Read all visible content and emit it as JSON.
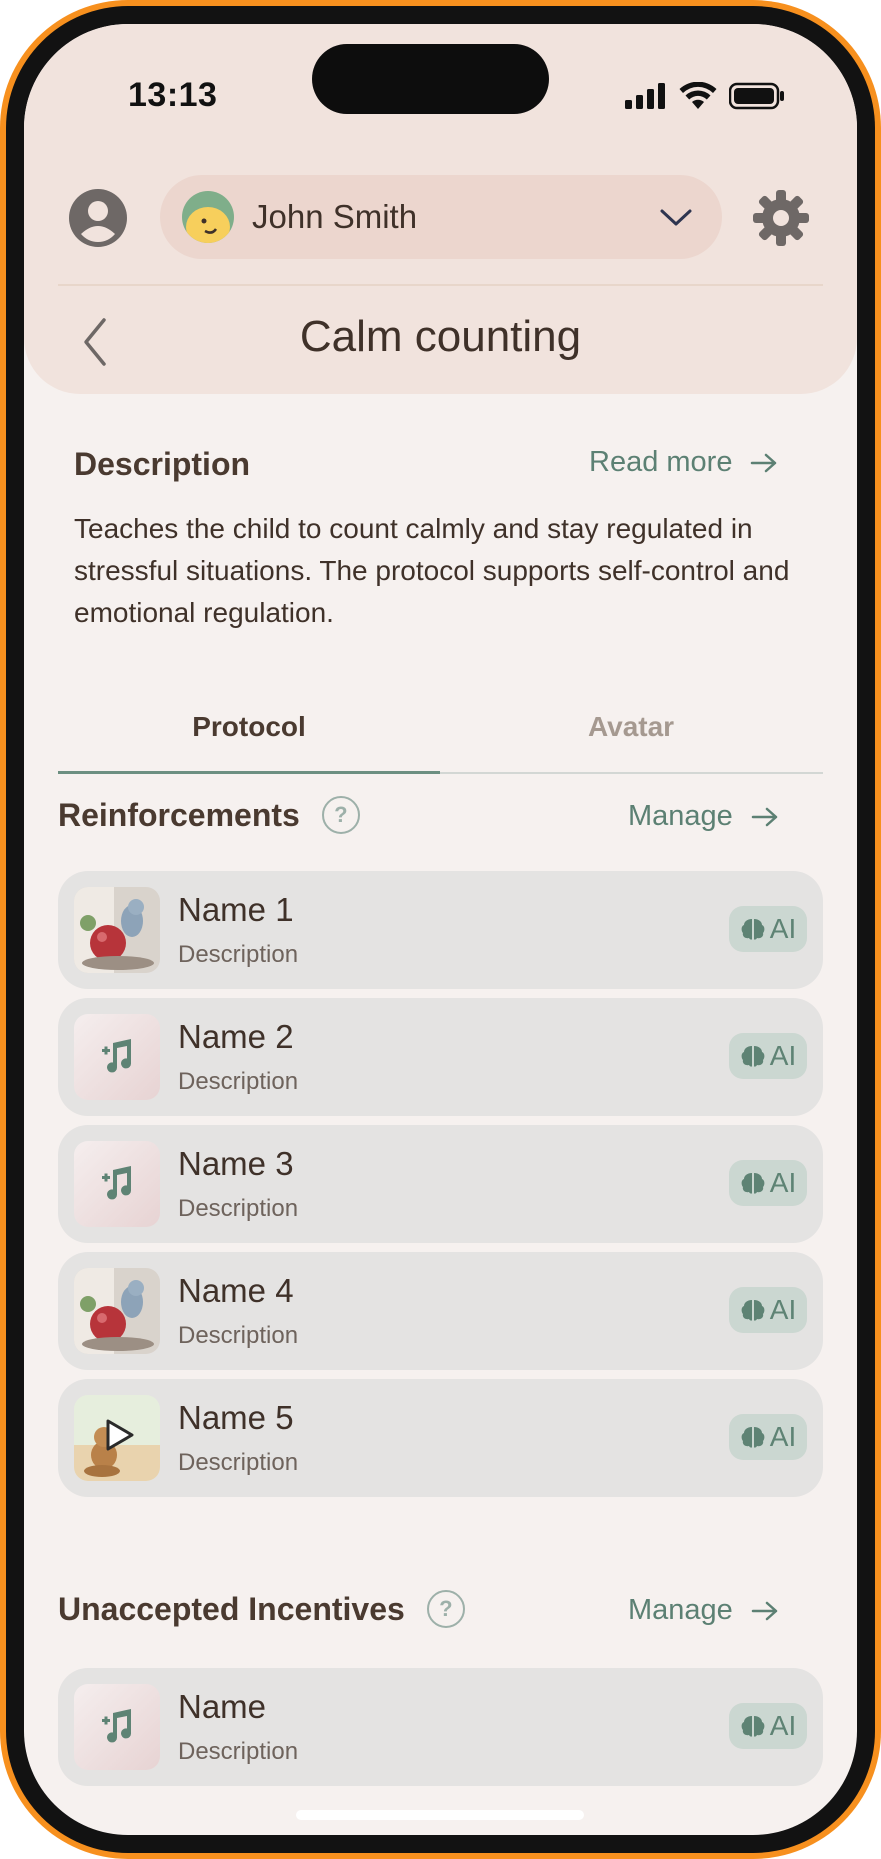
{
  "status_bar": {
    "time": "13:13"
  },
  "header": {
    "user_name": "John Smith",
    "page_title": "Calm counting"
  },
  "description": {
    "title": "Description",
    "read_more": "Read more",
    "text": "Teaches the child to count calmly and stay regulated in stressful situations. The protocol supports self-control and emotional regulation."
  },
  "tabs": [
    {
      "label": "Protocol",
      "active": true
    },
    {
      "label": "Avatar",
      "active": false
    }
  ],
  "reinforcements": {
    "title": "Reinforcements",
    "manage": "Manage",
    "items": [
      {
        "name": "Name 1",
        "description": "Description",
        "badge": "AI",
        "thumb": "image"
      },
      {
        "name": "Name 2",
        "description": "Description",
        "badge": "AI",
        "thumb": "music-icon"
      },
      {
        "name": "Name 3",
        "description": "Description",
        "badge": "AI",
        "thumb": "music-icon"
      },
      {
        "name": "Name 4",
        "description": "Description",
        "badge": "AI",
        "thumb": "image"
      },
      {
        "name": "Name 5",
        "description": "Description",
        "badge": "AI",
        "thumb": "video"
      }
    ]
  },
  "unaccepted": {
    "title": "Unaccepted Incentives",
    "manage": "Manage",
    "items": [
      {
        "name": "Name",
        "description": "Description",
        "badge": "AI",
        "thumb": "music-icon"
      }
    ]
  },
  "colors": {
    "accent": "#5C8073",
    "frame": "#F7901E",
    "header_bg": "#F1E3DD",
    "card_bg": "#E4E3E2"
  }
}
